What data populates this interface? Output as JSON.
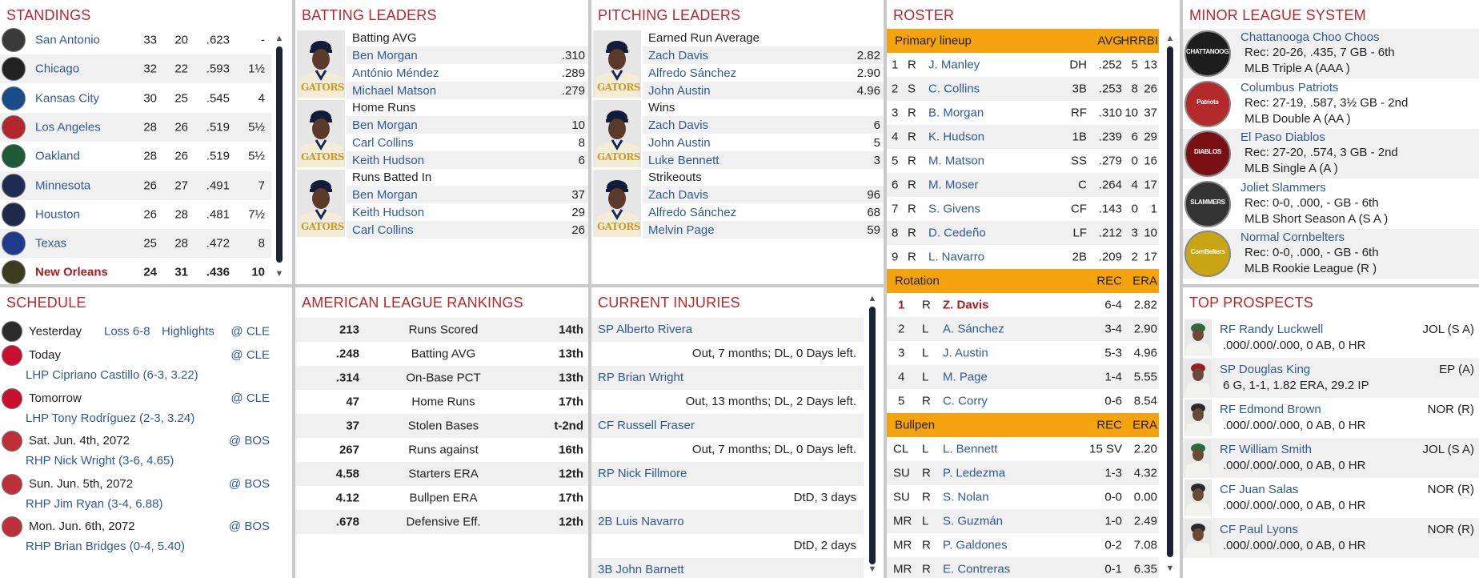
{
  "standings": {
    "title": "STANDINGS",
    "rows": [
      {
        "team": "San Antonio",
        "w": "33",
        "l": "20",
        "pct": ".623",
        "gb": "-",
        "logo": "#3a3a3a"
      },
      {
        "team": "Chicago",
        "w": "32",
        "l": "22",
        "pct": ".593",
        "gb": "1½",
        "logo": "#222"
      },
      {
        "team": "Kansas City",
        "w": "30",
        "l": "25",
        "pct": ".545",
        "gb": "4",
        "logo": "#1a4c8a"
      },
      {
        "team": "Los Angeles",
        "w": "28",
        "l": "26",
        "pct": ".519",
        "gb": "5½",
        "logo": "#b3262b"
      },
      {
        "team": "Oakland",
        "w": "28",
        "l": "26",
        "pct": ".519",
        "gb": "5½",
        "logo": "#1d5a3a"
      },
      {
        "team": "Minnesota",
        "w": "26",
        "l": "27",
        "pct": ".491",
        "gb": "7",
        "logo": "#1e2c55"
      },
      {
        "team": "Houston",
        "w": "26",
        "l": "28",
        "pct": ".481",
        "gb": "7½",
        "logo": "#1f2a4a"
      },
      {
        "team": "Texas",
        "w": "25",
        "l": "28",
        "pct": ".472",
        "gb": "8",
        "logo": "#1d3b8a"
      },
      {
        "team": "New Orleans",
        "w": "24",
        "l": "31",
        "pct": ".436",
        "gb": "10",
        "logo": "#3b3b1e"
      }
    ]
  },
  "batting": {
    "title": "BATTING LEADERS",
    "groups": [
      {
        "label": "Batting AVG",
        "rows": [
          {
            "name": "Ben Morgan",
            "val": ".310"
          },
          {
            "name": "António Méndez",
            "val": ".289"
          },
          {
            "name": "Michael Matson",
            "val": ".279"
          }
        ]
      },
      {
        "label": "Home Runs",
        "rows": [
          {
            "name": "Ben Morgan",
            "val": "10"
          },
          {
            "name": "Carl Collins",
            "val": "8"
          },
          {
            "name": "Keith Hudson",
            "val": "6"
          }
        ]
      },
      {
        "label": "Runs Batted In",
        "rows": [
          {
            "name": "Ben Morgan",
            "val": "37"
          },
          {
            "name": "Keith Hudson",
            "val": "29"
          },
          {
            "name": "Carl Collins",
            "val": "26"
          }
        ]
      }
    ]
  },
  "pitching": {
    "title": "PITCHING LEADERS",
    "groups": [
      {
        "label": "Earned Run Average",
        "rows": [
          {
            "name": "Zach Davis",
            "val": "2.82"
          },
          {
            "name": "Alfredo Sánchez",
            "val": "2.90"
          },
          {
            "name": "John Austin",
            "val": "4.96"
          }
        ]
      },
      {
        "label": "Wins",
        "rows": [
          {
            "name": "Zach Davis",
            "val": "6"
          },
          {
            "name": "John Austin",
            "val": "5"
          },
          {
            "name": "Luke Bennett",
            "val": "3"
          }
        ]
      },
      {
        "label": "Strikeouts",
        "rows": [
          {
            "name": "Zach Davis",
            "val": "96"
          },
          {
            "name": "Alfredo Sánchez",
            "val": "68"
          },
          {
            "name": "Melvin Page",
            "val": "59"
          }
        ]
      }
    ]
  },
  "jersey_text": "GATORS",
  "roster": {
    "title": "ROSTER",
    "lineup_header": {
      "label": "Primary lineup",
      "c1": "AVG",
      "c2": "HR",
      "c3": "RBI"
    },
    "lineup": [
      {
        "n": "1",
        "b": "R",
        "name": "J. Manley",
        "pos": "DH",
        "avg": ".252",
        "hr": "5",
        "rbi": "13"
      },
      {
        "n": "2",
        "b": "S",
        "name": "C. Collins",
        "pos": "3B",
        "avg": ".253",
        "hr": "8",
        "rbi": "26"
      },
      {
        "n": "3",
        "b": "R",
        "name": "B. Morgan",
        "pos": "RF",
        "avg": ".310",
        "hr": "10",
        "rbi": "37"
      },
      {
        "n": "4",
        "b": "R",
        "name": "K. Hudson",
        "pos": "1B",
        "avg": ".239",
        "hr": "6",
        "rbi": "29"
      },
      {
        "n": "5",
        "b": "R",
        "name": "M. Matson",
        "pos": "SS",
        "avg": ".279",
        "hr": "0",
        "rbi": "16"
      },
      {
        "n": "6",
        "b": "R",
        "name": "M. Moser",
        "pos": "C",
        "avg": ".264",
        "hr": "4",
        "rbi": "17"
      },
      {
        "n": "7",
        "b": "R",
        "name": "S. Givens",
        "pos": "CF",
        "avg": ".143",
        "hr": "0",
        "rbi": "1"
      },
      {
        "n": "8",
        "b": "R",
        "name": "D. Cedeño",
        "pos": "LF",
        "avg": ".212",
        "hr": "3",
        "rbi": "10"
      },
      {
        "n": "9",
        "b": "R",
        "name": "L. Navarro",
        "pos": "2B",
        "avg": ".209",
        "hr": "2",
        "rbi": "17"
      }
    ],
    "rotation_header": {
      "label": "Rotation",
      "c1": "REC",
      "c2": "ERA"
    },
    "rotation": [
      {
        "n": "1",
        "t": "R",
        "name": "Z. Davis",
        "rec": "6-4",
        "era": "2.82"
      },
      {
        "n": "2",
        "t": "L",
        "name": "A. Sánchez",
        "rec": "3-4",
        "era": "2.90"
      },
      {
        "n": "3",
        "t": "L",
        "name": "J. Austin",
        "rec": "5-3",
        "era": "4.96"
      },
      {
        "n": "4",
        "t": "L",
        "name": "M. Page",
        "rec": "1-4",
        "era": "5.55"
      },
      {
        "n": "5",
        "t": "R",
        "name": "C. Corry",
        "rec": "0-6",
        "era": "8.54"
      }
    ],
    "bullpen_header": {
      "label": "Bullpen",
      "c1": "REC",
      "c2": "ERA"
    },
    "bullpen": [
      {
        "role": "CL",
        "t": "L",
        "name": "L. Bennett",
        "rec": "15 SV",
        "era": "2.20"
      },
      {
        "role": "SU",
        "t": "R",
        "name": "P. Ledezma",
        "rec": "1-3",
        "era": "4.32"
      },
      {
        "role": "SU",
        "t": "R",
        "name": "S. Nolan",
        "rec": "0-0",
        "era": "0.00"
      },
      {
        "role": "MR",
        "t": "L",
        "name": "S. Guzmán",
        "rec": "1-0",
        "era": "2.49"
      },
      {
        "role": "MR",
        "t": "R",
        "name": "P. Galdones",
        "rec": "0-2",
        "era": "7.08"
      },
      {
        "role": "MR",
        "t": "R",
        "name": "E. Contreras",
        "rec": "0-1",
        "era": "6.35"
      }
    ]
  },
  "minors": {
    "title": "MINOR LEAGUE SYSTEM",
    "rows": [
      {
        "name": "Chattanooga Choo Choos",
        "rec": "Rec: 20-26, .435, 7 GB - 6th",
        "level": "MLB Triple A (AAA )",
        "logo_color": "#1d1d1d",
        "logo_text": "CHATTANOOGA"
      },
      {
        "name": "Columbus Patriots",
        "rec": "Rec: 27-19, .587, 3½ GB - 2nd",
        "level": "MLB Double A (AA )",
        "logo_color": "#b22a2a",
        "logo_text": "Patriots"
      },
      {
        "name": "El Paso Diablos",
        "rec": "Rec: 27-20, .574, 3 GB - 2nd",
        "level": "MLB Single A (A )",
        "logo_color": "#7a1014",
        "logo_text": "DIABLOS"
      },
      {
        "name": "Joliet Slammers",
        "rec": "Rec: 0-0, .000, - GB - 6th",
        "level": "MLB Short Season A (S A )",
        "logo_color": "#333",
        "logo_text": "SLAMMERS"
      },
      {
        "name": "Normal Cornbelters",
        "rec": "Rec: 0-0, .000, - GB - 6th",
        "level": "MLB Rookie League (R )",
        "logo_color": "#c9a514",
        "logo_text": "CornBelters"
      }
    ]
  },
  "schedule": {
    "title": "SCHEDULE",
    "yesterday": {
      "label": "Yesterday",
      "result": "Loss 6-8",
      "highlights": "Highlights",
      "opp": "@ CLE"
    },
    "games": [
      {
        "date": "Today",
        "opp": "@ CLE",
        "pitcher": "LHP Cipriano Castillo (6-3, 3.22)",
        "logo": "#c8102e"
      },
      {
        "date": "Tomorrow",
        "opp": "@ CLE",
        "pitcher": "LHP Tony Rodríguez (2-3, 3.24)",
        "logo": "#c8102e"
      },
      {
        "date": "Sat. Jun. 4th, 2072",
        "opp": "@ BOS",
        "pitcher": "RHP Nick Wright (3-6, 4.65)",
        "logo": "#bd3039"
      },
      {
        "date": "Sun. Jun. 5th, 2072",
        "opp": "@ BOS",
        "pitcher": "RHP Jim Ryan (3-4, 6.88)",
        "logo": "#bd3039"
      },
      {
        "date": "Mon. Jun. 6th, 2072",
        "opp": "@ BOS",
        "pitcher": "RHP Brian Bridges (0-4, 5.40)",
        "logo": "#bd3039"
      }
    ]
  },
  "rankings": {
    "title": "AMERICAN LEAGUE RANKINGS",
    "rows": [
      {
        "val": "213",
        "stat": "Runs Scored",
        "rank": "14th"
      },
      {
        "val": ".248",
        "stat": "Batting AVG",
        "rank": "13th"
      },
      {
        "val": ".314",
        "stat": "On-Base PCT",
        "rank": "13th"
      },
      {
        "val": "47",
        "stat": "Home Runs",
        "rank": "17th"
      },
      {
        "val": "37",
        "stat": "Stolen Bases",
        "rank": "t-2nd"
      },
      {
        "val": "267",
        "stat": "Runs against",
        "rank": "16th"
      },
      {
        "val": "4.58",
        "stat": "Starters ERA",
        "rank": "12th"
      },
      {
        "val": "4.12",
        "stat": "Bullpen ERA",
        "rank": "17th"
      },
      {
        "val": ".678",
        "stat": "Defensive Eff.",
        "rank": "12th"
      }
    ]
  },
  "injuries": {
    "title": "CURRENT INJURIES",
    "rows": [
      {
        "player": "SP Alberto Rivera",
        "status": "Out, 7 months; DL, 0 Days left."
      },
      {
        "player": "RP Brian Wright",
        "status": "Out, 13 months; DL, 2 Days left."
      },
      {
        "player": "CF Russell Fraser",
        "status": "Out, 7 months; DL, 0 Days left."
      },
      {
        "player": "RP Nick Fillmore",
        "status": "DtD, 3 days"
      },
      {
        "player": "2B Luis Navarro",
        "status": "DtD, 2 days"
      },
      {
        "player": "3B John Barnett",
        "status": ""
      }
    ]
  },
  "prospects": {
    "title": "TOP PROSPECTS",
    "rows": [
      {
        "name": "RF Randy Luckwell",
        "team": "JOL (S A)",
        "line": ".000/.000/.000, 0 AB, 0 HR",
        "cap": "#2c6b3a"
      },
      {
        "name": "SP Douglas King",
        "team": "EP (A)",
        "line": "6 G, 1-1, 1.82 ERA, 29.2 IP",
        "cap": "#9c1c22"
      },
      {
        "name": "RF Edmond Brown",
        "team": "NOR (R)",
        "line": ".000/.000/.000, 0 AB, 0 HR",
        "cap": "#2a2a2a"
      },
      {
        "name": "RF William Smith",
        "team": "JOL (S A)",
        "line": ".000/.000/.000, 0 AB, 0 HR",
        "cap": "#2c6b3a"
      },
      {
        "name": "CF Juan Salas",
        "team": "NOR (R)",
        "line": ".000/.000/.000, 0 AB, 0 HR",
        "cap": "#2a2a2a"
      },
      {
        "name": "CF Paul Lyons",
        "team": "NOR (R)",
        "line": ".000/.000/.000, 0 AB, 0 HR",
        "cap": "#2a2a2a"
      }
    ]
  }
}
